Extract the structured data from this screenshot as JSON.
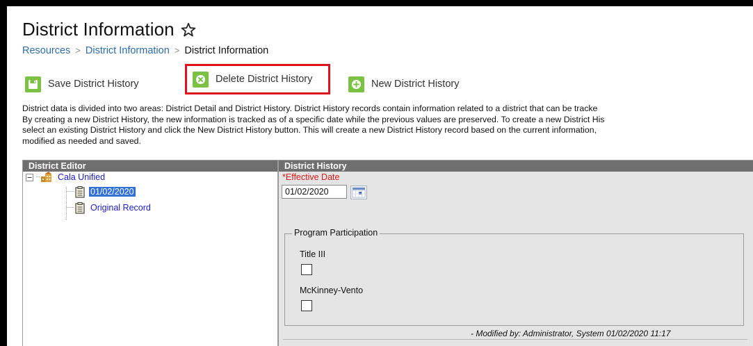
{
  "header": {
    "title": "District Information",
    "star_icon": "star-outline-icon"
  },
  "breadcrumb": [
    {
      "label": "Resources"
    },
    {
      "label": "District Information"
    },
    {
      "label": "District Information"
    }
  ],
  "toolbar": {
    "save_label": "Save District History",
    "delete_label": "Delete District History",
    "new_label": "New District History",
    "accent_color": "#7cc242",
    "highlight_color": "#e0121b"
  },
  "description": {
    "lines": [
      "District data is divided into two areas: District Detail and District History. District History records contain information related to a district that can be tracke",
      "By creating a new District History, the new information is tracked as of a specific date while the previous values are preserved. To create a new District His",
      "select an existing District History and click the New District History button. This will create a new District History record based on the current information,",
      "modified as needed and saved."
    ]
  },
  "district_editor": {
    "title": "District Editor",
    "root": {
      "label": "Cala Unified",
      "icon": "district-building-icon"
    },
    "items": [
      {
        "label": "01/02/2020",
        "selected": true,
        "icon": "record-clipboard-icon"
      },
      {
        "label": "Original Record",
        "selected": false,
        "icon": "record-clipboard-icon"
      }
    ]
  },
  "district_history": {
    "title": "District History",
    "effective_date_label": "*Effective Date",
    "effective_date_value": "01/02/2020",
    "program_participation": {
      "legend": "Program Participation",
      "fields": [
        {
          "label": "Title III",
          "checked": false
        },
        {
          "label": "McKinney-Vento",
          "checked": false
        }
      ]
    },
    "modified_by": "- Modified by: Administrator, System 01/02/2020 11:17"
  }
}
